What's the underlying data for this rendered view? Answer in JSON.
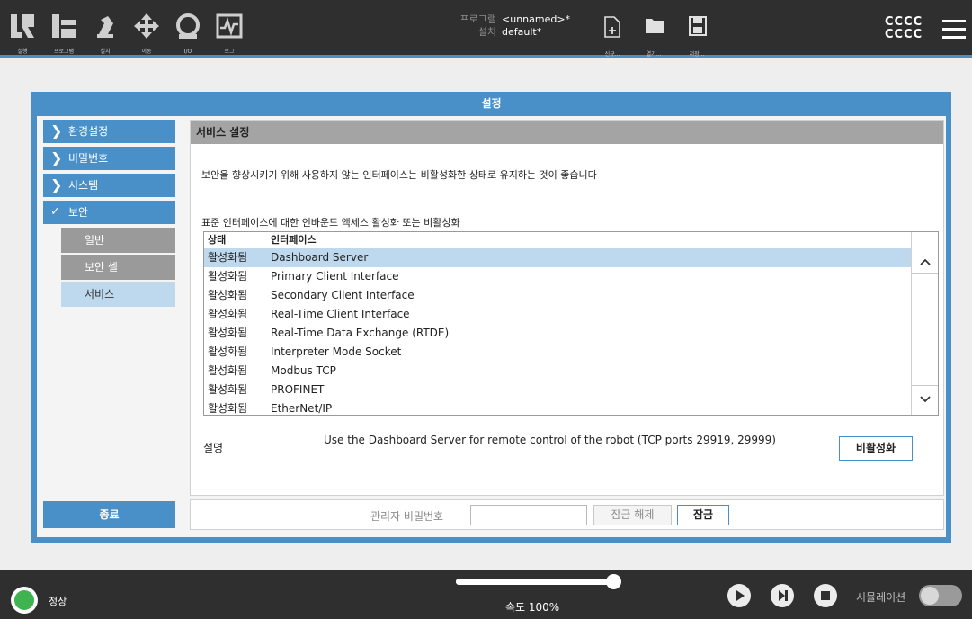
{
  "nav": {
    "items": [
      {
        "label": "실행",
        "icon": "run-icon"
      },
      {
        "label": "프로그램",
        "icon": "program-icon"
      },
      {
        "label": "설치",
        "icon": "install-icon"
      },
      {
        "label": "이동",
        "icon": "move-icon"
      },
      {
        "label": "I/O",
        "icon": "io-icon"
      },
      {
        "label": "로그",
        "icon": "log-icon"
      }
    ]
  },
  "program": {
    "program_label": "프로그램",
    "program_value": "<unnamed>*",
    "install_label": "설치",
    "install_value": "default*"
  },
  "file_buttons": {
    "new_label": "신규...",
    "open_label": "열기...",
    "save_label": "저장..."
  },
  "user": {
    "line1": "CCCC",
    "line2": "CCCC"
  },
  "dialog": {
    "title": "설정",
    "sidebar": {
      "preferences": "환경설정",
      "password": "비밀번호",
      "system": "시스템",
      "security": "보안",
      "sub_general": "일반",
      "sub_safety_cell": "보안 셀",
      "sub_services": "서비스"
    },
    "exit_label": "종료",
    "section_title": "서비스 설정",
    "description": "보안을 향상시키기 위해 사용하지 않는 인터페이스는 비활성화한 상태로 유지하는 것이 좋습니다",
    "list_caption": "표준 인터페이스에 대한 인바운드 액세스 활성화 또는 비활성화",
    "columns": {
      "status": "상태",
      "interface": "인터페이스"
    },
    "rows": [
      {
        "status": "활성화됨",
        "name": "Dashboard Server"
      },
      {
        "status": "활성화됨",
        "name": "Primary Client Interface"
      },
      {
        "status": "활성화됨",
        "name": "Secondary Client Interface"
      },
      {
        "status": "활성화됨",
        "name": "Real-Time Client Interface"
      },
      {
        "status": "활성화됨",
        "name": "Real-Time Data Exchange (RTDE)"
      },
      {
        "status": "활성화됨",
        "name": "Interpreter Mode Socket"
      },
      {
        "status": "활성화됨",
        "name": "Modbus TCP"
      },
      {
        "status": "활성화됨",
        "name": "PROFINET"
      },
      {
        "status": "활성화됨",
        "name": "EtherNet/IP"
      }
    ],
    "explain_label": "설명",
    "explain_text": "Use the Dashboard Server for remote control of the robot (TCP ports 29919, 29999)",
    "disable_label": "비활성화",
    "admin_pwd_label": "관리자 비밀번호",
    "admin_pwd_value": "",
    "unlock_label": "잠금 해제",
    "lock_label": "잠금"
  },
  "footer": {
    "status": "정상",
    "speed_text": "속도 100%",
    "speed_fraction": 1.0,
    "sim_label": "시뮬레이션"
  },
  "colors": {
    "accent": "#4a90c8",
    "header_bg": "#2f2f2f",
    "selected_row": "#bed8ee",
    "status_ok": "#3fb34f"
  }
}
